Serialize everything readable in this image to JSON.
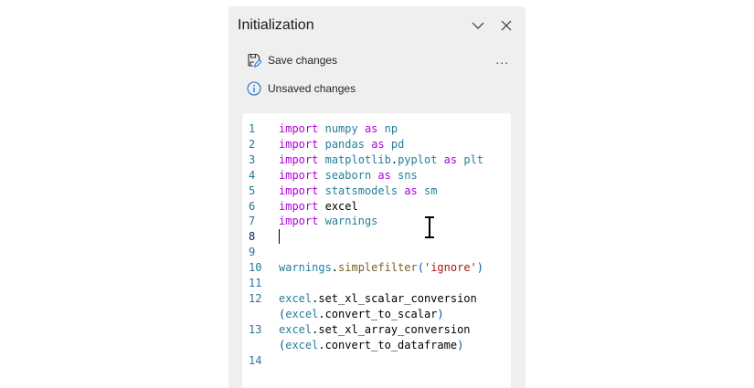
{
  "panel": {
    "title": "Initialization",
    "save_label": "Save changes",
    "status": "Unsaved changes",
    "more_label": "..."
  },
  "editor": {
    "active_line": 8,
    "lines": [
      {
        "num": "1",
        "tokens": [
          [
            "import",
            "kw"
          ],
          [
            " ",
            "plain"
          ],
          [
            "numpy",
            "mod"
          ],
          [
            " ",
            "plain"
          ],
          [
            "as",
            "kw"
          ],
          [
            " ",
            "plain"
          ],
          [
            "np",
            "mod"
          ]
        ]
      },
      {
        "num": "2",
        "tokens": [
          [
            "import",
            "kw"
          ],
          [
            " ",
            "plain"
          ],
          [
            "pandas",
            "mod"
          ],
          [
            " ",
            "plain"
          ],
          [
            "as",
            "kw"
          ],
          [
            " ",
            "plain"
          ],
          [
            "pd",
            "mod"
          ]
        ]
      },
      {
        "num": "3",
        "tokens": [
          [
            "import",
            "kw"
          ],
          [
            " ",
            "plain"
          ],
          [
            "matplotlib",
            "mod"
          ],
          [
            ".",
            "plain"
          ],
          [
            "pyplot",
            "mod"
          ],
          [
            " ",
            "plain"
          ],
          [
            "as",
            "kw"
          ],
          [
            " ",
            "plain"
          ],
          [
            "plt",
            "mod"
          ]
        ]
      },
      {
        "num": "4",
        "tokens": [
          [
            "import",
            "kw"
          ],
          [
            " ",
            "plain"
          ],
          [
            "seaborn",
            "mod"
          ],
          [
            " ",
            "plain"
          ],
          [
            "as",
            "kw"
          ],
          [
            " ",
            "plain"
          ],
          [
            "sns",
            "mod"
          ]
        ]
      },
      {
        "num": "5",
        "tokens": [
          [
            "import",
            "kw"
          ],
          [
            " ",
            "plain"
          ],
          [
            "statsmodels",
            "mod"
          ],
          [
            " ",
            "plain"
          ],
          [
            "as",
            "kw"
          ],
          [
            " ",
            "plain"
          ],
          [
            "sm",
            "mod"
          ]
        ]
      },
      {
        "num": "6",
        "tokens": [
          [
            "import",
            "kw"
          ],
          [
            " ",
            "plain"
          ],
          [
            "excel",
            "plain"
          ]
        ]
      },
      {
        "num": "7",
        "tokens": [
          [
            "import",
            "kw"
          ],
          [
            " ",
            "plain"
          ],
          [
            "warnings",
            "mod"
          ]
        ]
      },
      {
        "num": "8",
        "tokens": []
      },
      {
        "num": "9",
        "tokens": []
      },
      {
        "num": "10",
        "tokens": [
          [
            "warnings",
            "mod"
          ],
          [
            ".",
            "plain"
          ],
          [
            "simplefilter",
            "fn"
          ],
          [
            "(",
            "par"
          ],
          [
            "'ignore'",
            "str"
          ],
          [
            ")",
            "par"
          ]
        ]
      },
      {
        "num": "11",
        "tokens": []
      },
      {
        "num": "12",
        "tokens": [
          [
            "excel",
            "mod"
          ],
          [
            ".set_xl_scalar_conversion",
            "plain"
          ]
        ]
      },
      {
        "num": "",
        "tokens": [
          [
            "(",
            "par"
          ],
          [
            "excel",
            "mod"
          ],
          [
            ".convert_to_scalar",
            "plain"
          ],
          [
            ")",
            "par"
          ]
        ]
      },
      {
        "num": "13",
        "tokens": [
          [
            "excel",
            "mod"
          ],
          [
            ".set_xl_array_conversion",
            "plain"
          ]
        ]
      },
      {
        "num": "",
        "tokens": [
          [
            "(",
            "par"
          ],
          [
            "excel",
            "mod"
          ],
          [
            ".convert_to_dataframe",
            "plain"
          ],
          [
            ")",
            "par"
          ]
        ]
      },
      {
        "num": "14",
        "tokens": []
      }
    ]
  }
}
